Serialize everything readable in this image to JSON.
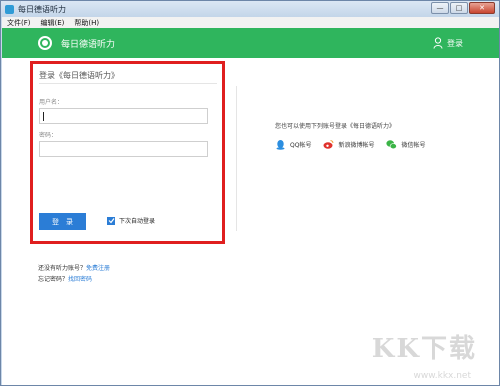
{
  "window": {
    "title": "每日德语听力",
    "minimize_label": "—",
    "maximize_label": "□",
    "close_label": "✕"
  },
  "menu": [
    "文件(F)",
    "编辑(E)",
    "帮助(H)"
  ],
  "header": {
    "app_name": "每日德语听力",
    "login_label": "登录"
  },
  "login": {
    "title": "登录《每日德语听力》",
    "username_label": "用户名：",
    "username_value": "",
    "password_label": "密码：",
    "password_value": "",
    "submit_label": "登　录",
    "remember_label": "下次自动登录",
    "remember_checked": true
  },
  "third_party": {
    "title": "您也可以使用下列账号登录《每日德语听力》",
    "providers": [
      {
        "label": "QQ帐号",
        "icon": "qq-icon",
        "color": "#2b8ee0"
      },
      {
        "label": "新浪微博帐号",
        "icon": "weibo-icon",
        "color": "#e0322c"
      },
      {
        "label": "微信帐号",
        "icon": "wechat-icon",
        "color": "#3bb446"
      }
    ]
  },
  "bottom": {
    "no_account_text": "还没有听力账号？",
    "register_link": "免费注册",
    "forgot_text": "忘记密码？",
    "reset_link": "找回密码"
  },
  "watermark": {
    "brand": "KK下载",
    "url": "www.kkx.net"
  },
  "colors": {
    "header_green": "#2fb55d",
    "accent_blue": "#2b7dd6",
    "highlight_red": "#e01f1f"
  }
}
